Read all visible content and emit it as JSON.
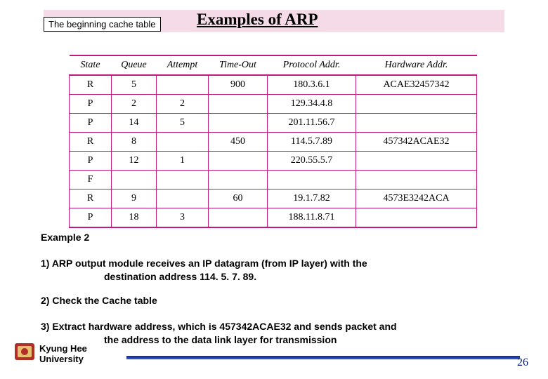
{
  "header": {
    "subtitle": "The beginning cache table",
    "title": "Examples of ARP"
  },
  "table": {
    "headers": {
      "state": "State",
      "queue": "Queue",
      "attempt": "Attempt",
      "timeout": "Time-Out",
      "proto": "Protocol Addr.",
      "hw": "Hardware Addr."
    },
    "rows": [
      {
        "state": "R",
        "queue": "5",
        "attempt": "",
        "timeout": "900",
        "proto": "180.3.6.1",
        "hw": "ACAE32457342"
      },
      {
        "state": "P",
        "queue": "2",
        "attempt": "2",
        "timeout": "",
        "proto": "129.34.4.8",
        "hw": ""
      },
      {
        "state": "P",
        "queue": "14",
        "attempt": "5",
        "timeout": "",
        "proto": "201.11.56.7",
        "hw": ""
      },
      {
        "state": "R",
        "queue": "8",
        "attempt": "",
        "timeout": "450",
        "proto": "114.5.7.89",
        "hw": "457342ACAE32"
      },
      {
        "state": "P",
        "queue": "12",
        "attempt": "1",
        "timeout": "",
        "proto": "220.55.5.7",
        "hw": ""
      },
      {
        "state": "F",
        "queue": "",
        "attempt": "",
        "timeout": "",
        "proto": "",
        "hw": ""
      },
      {
        "state": "R",
        "queue": "9",
        "attempt": "",
        "timeout": "60",
        "proto": "19.1.7.82",
        "hw": "4573E3242ACA"
      },
      {
        "state": "P",
        "queue": "18",
        "attempt": "3",
        "timeout": "",
        "proto": "188.11.8.71",
        "hw": ""
      }
    ]
  },
  "example_label": "Example 2",
  "points": {
    "p1a": "1) ARP output module receives an IP datagram (from IP layer) with the",
    "p1b": "destination address 114. 5. 7. 89.",
    "p2": "2) Check the Cache table",
    "p3a": "3) Extract hardware address, which is 457342ACAE32 and sends packet and",
    "p3b": "the address to the data link layer for transmission"
  },
  "footer": {
    "uni1": "Kyung Hee",
    "uni2": "University",
    "page": "26"
  }
}
